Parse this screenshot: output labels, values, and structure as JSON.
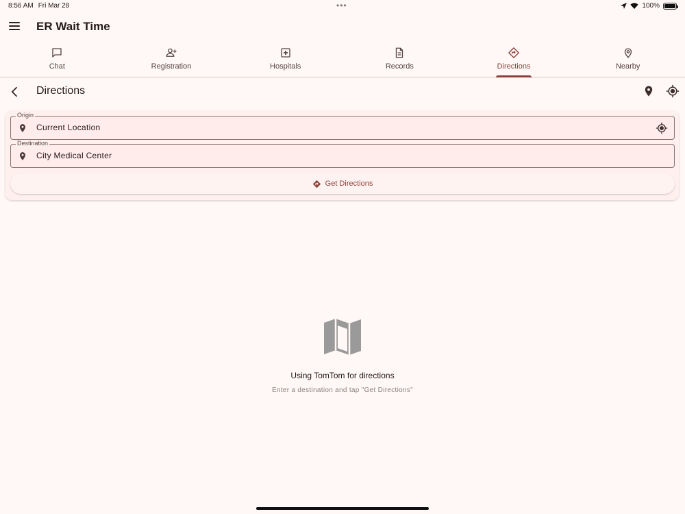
{
  "status_bar": {
    "time": "8:56 AM",
    "date": "Fri Mar 28",
    "battery": "100%"
  },
  "app": {
    "title": "ER Wait Time"
  },
  "tabs": [
    {
      "label": "Chat",
      "icon": "chat-icon"
    },
    {
      "label": "Registration",
      "icon": "person-add-icon"
    },
    {
      "label": "Hospitals",
      "icon": "hospital-icon"
    },
    {
      "label": "Records",
      "icon": "document-icon"
    },
    {
      "label": "Directions",
      "icon": "directions-icon",
      "active": true
    },
    {
      "label": "Nearby",
      "icon": "location-pin-icon"
    }
  ],
  "page": {
    "title": "Directions"
  },
  "form": {
    "origin_label": "Origin",
    "origin_value": "Current Location",
    "destination_label": "Destination",
    "destination_value": "City Medical Center",
    "button_label": "Get Directions"
  },
  "empty_state": {
    "title": "Using TomTom for directions",
    "subtitle": "Enter a destination and tap \"Get Directions\""
  },
  "colors": {
    "accent": "#8c3f38",
    "background": "#fff8f6",
    "card": "#fff0ee"
  }
}
